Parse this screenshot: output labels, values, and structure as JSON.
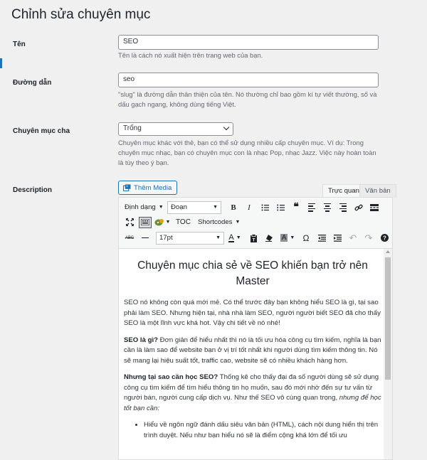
{
  "page": {
    "title": "Chỉnh sửa chuyên mục"
  },
  "fields": {
    "name": {
      "label": "Tên",
      "value": "SEO",
      "help": "Tên là cách nó xuất hiện trên trang web của bạn."
    },
    "slug": {
      "label": "Đường dẫn",
      "value": "seo",
      "help": "\"slug\" là đường dẫn thân thiện của tên. Nó thường chỉ bao gồm kí tự viết thường, số và dấu gạch ngang, không dùng tiếng Việt."
    },
    "parent": {
      "label": "Chuyên mục cha",
      "value": "Trống",
      "help": "Chuyên mục khác với thẻ, bạn có thể sử dụng nhiều cấp chuyên mục. Ví dụ: Trong chuyên mục nhạc, bạn có chuyên mục con là nhạc Pop, nhạc Jazz. Việc này hoàn toàn là tùy theo ý bạn."
    },
    "description": {
      "label": "Description"
    }
  },
  "editor": {
    "add_media": "Thêm Media",
    "tabs": {
      "visual": "Trực quan",
      "text": "Văn bản"
    },
    "toolbar": {
      "format": "Định dạng",
      "paragraph": "Đoạn",
      "toc": "TOC",
      "shortcodes": "Shortcodes",
      "font_size": "17pt",
      "abc": "ABC",
      "omega": "Ω"
    },
    "content": {
      "title": "Chuyên mục chia sẻ về SEO khiến bạn trở nên Master",
      "p1": "SEO nó không còn quá mới mẻ. Có thể trước đây bạn không hiểu SEO là gì, tại sao phải làm SEO. Nhưng hiện tại, nhà nhà làm SEO, người người biết SEO đã cho thấy SEO là một lĩnh vực khá hot. Vậy chi tiết về nó nhé!",
      "p2_bold": "SEO là gì?",
      "p2": " Đơn giản để hiểu nhất thì nó là tối ưu hóa công cụ tìm kiếm, nghĩa là bạn cần là làm sao để website bạn ở vị trí tốt nhất khi người dùng tìm kiếm thông tin. Nó sẽ mang lại hiệu suất tốt, traffic cao, website sẽ có nhiều khách hàng hơn.",
      "p3_bold": "Nhưng tại sao cần học SEO?",
      "p3": " Thống kê cho thấy đại đa số người dùng sẽ sử dụng công cụ tìm kiếm để tìm hiểu thông tin họ muốn, sau đó mới nhờ đến sự tư vấn từ người bán, người cung cấp dịch vụ. Như thế SEO vô cùng quan trọng, ",
      "p3_italic": "nhưng để học tốt bạn cần:",
      "li1": "Hiểu về ngôn ngữ đánh dấu siêu văn bản (HTML), cách nội dung hiển thị trên trình duyệt. Nếu như bạn hiểu nó sẽ là điểm cộng khá lớn để tối ưu"
    }
  },
  "colors": {
    "accent": "#2271b1",
    "background": "#f0f0f1"
  }
}
